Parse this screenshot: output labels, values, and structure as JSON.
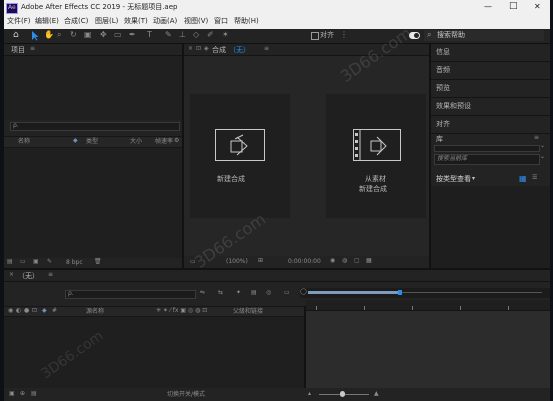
{
  "window": {
    "title": "Adobe After Effects CC 2019 - 无标题项目.aep",
    "app_badge": "Ae",
    "controls": {
      "minimize": "—",
      "maximize": "□",
      "close": "✕"
    }
  },
  "menu": [
    "文件(F)",
    "编辑(E)",
    "合成(C)",
    "图层(L)",
    "效果(T)",
    "动画(A)",
    "视图(V)",
    "窗口",
    "帮助(H)"
  ],
  "toolbar": {
    "align_label": "对齐",
    "search_placeholder": "搜索帮助"
  },
  "project_panel": {
    "title": "项目",
    "menu_icon": "≡",
    "search_placeholder": "ρ.",
    "columns": {
      "name": "名称",
      "type": "类型",
      "size": "大小",
      "framerate": "帧速率"
    },
    "footer_bpc": "8 bpc"
  },
  "composition_panel": {
    "tab_label": "合成",
    "tab_value": "（无）",
    "new_comp_label": "新建合成",
    "from_footage_line1": "从素材",
    "from_footage_line2": "新建合成",
    "zoom_value": "(100%)",
    "timecode": "0:00:00:00"
  },
  "right_panels": {
    "items": [
      "信息",
      "音频",
      "预览",
      "效果和预设",
      "对齐",
      "库"
    ],
    "library_search_placeholder": "搜索当前库",
    "view_by_label": "按类型查看"
  },
  "timeline": {
    "tab_label": "（无）",
    "search_placeholder": "ρ.",
    "col_layer_name": "源名称",
    "col_parent": "父级和链接",
    "switch_modes_label": "切换开关/模式"
  },
  "watermark": "3D66.com",
  "colors": {
    "accent_blue": "#2d8ceb",
    "panel": "#232323",
    "titlebar": "#f0f0f0"
  }
}
